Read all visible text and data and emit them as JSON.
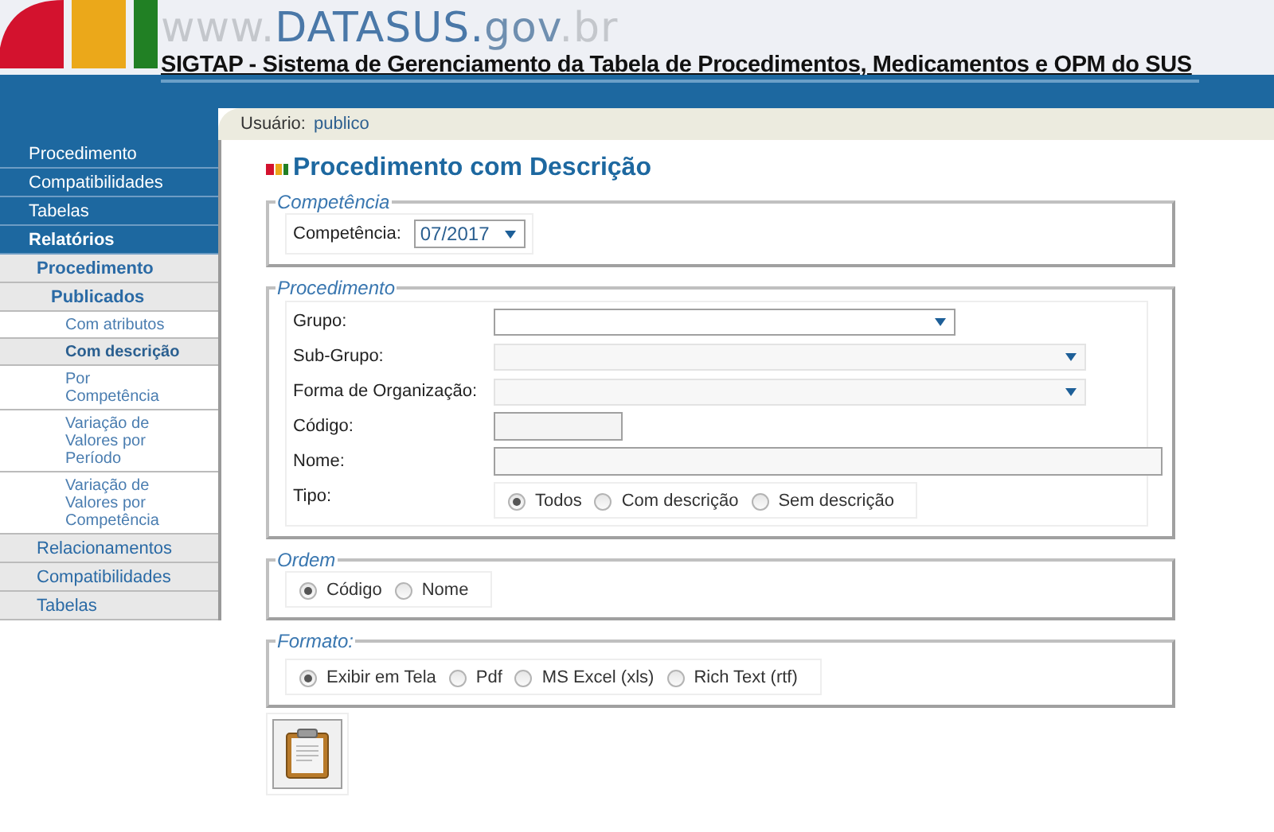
{
  "header": {
    "logo_parts": [
      {
        "text": "www.",
        "color": "#c4c7cc"
      },
      {
        "text": "DATASUS.",
        "color": "#4a78a8"
      },
      {
        "text": "gov",
        "color": "#6f8fb0"
      },
      {
        "text": ".br",
        "color": "#c4c7cc"
      }
    ],
    "title": "SIGTAP - Sistema de Gerenciamento da Tabela de Procedimentos, Medicamentos e OPM do SUS"
  },
  "user_bar": {
    "label": "Usuário:",
    "value": "publico"
  },
  "sidebar": {
    "items": [
      {
        "label": "Procedimento",
        "expanded": false
      },
      {
        "label": "Compatibilidades",
        "expanded": false
      },
      {
        "label": "Tabelas",
        "expanded": false
      },
      {
        "label": "Relatórios",
        "expanded": true,
        "children": [
          {
            "label": "Procedimento",
            "expanded": true,
            "children": [
              {
                "label": "Publicados",
                "expanded": true,
                "children": [
                  {
                    "label": "Com atributos",
                    "selected": false
                  },
                  {
                    "label": "Com descrição",
                    "selected": true
                  },
                  {
                    "label": "Por Competência",
                    "selected": false
                  },
                  {
                    "label": "Variação de Valores por Período",
                    "selected": false
                  },
                  {
                    "label": "Variação de Valores por Competência",
                    "selected": false
                  }
                ]
              }
            ]
          },
          {
            "label": "Relacionamentos",
            "expanded": false
          },
          {
            "label": "Compatibilidades",
            "expanded": false
          },
          {
            "label": "Tabelas",
            "expanded": false
          }
        ]
      }
    ]
  },
  "page_title": "Procedimento com Descrição",
  "competencia": {
    "legend": "Competência",
    "label": "Competência:",
    "value": "07/2017"
  },
  "procedimento": {
    "legend": "Procedimento",
    "fields": [
      {
        "kind": "select",
        "label": "Grupo:",
        "disabled": false
      },
      {
        "kind": "select",
        "label": "Sub-Grupo:",
        "disabled": true
      },
      {
        "kind": "select",
        "label": "Forma de Organização:",
        "disabled": true
      },
      {
        "kind": "text",
        "label": "Código:"
      },
      {
        "kind": "text",
        "label": "Nome:"
      },
      {
        "kind": "radio",
        "label": "Tipo:",
        "options": [
          {
            "label": "Todos",
            "selected": true
          },
          {
            "label": "Com descrição",
            "selected": false
          },
          {
            "label": "Sem descrição",
            "selected": false
          }
        ]
      }
    ]
  },
  "ordem": {
    "legend": "Ordem",
    "options": [
      {
        "label": "Código",
        "selected": true
      },
      {
        "label": "Nome",
        "selected": false
      }
    ]
  },
  "formato": {
    "legend": "Formato:",
    "options": [
      {
        "label": "Exibir em Tela",
        "selected": true
      },
      {
        "label": "Pdf",
        "selected": false
      },
      {
        "label": "MS Excel (xls)",
        "selected": false
      },
      {
        "label": "Rich Text (rtf)",
        "selected": false
      }
    ]
  }
}
